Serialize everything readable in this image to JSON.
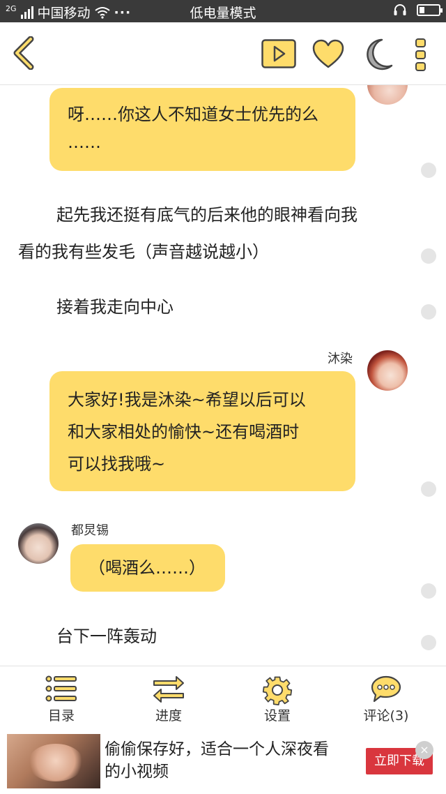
{
  "status_bar": {
    "network": "2G",
    "carrier": "中国移动",
    "dots": "···",
    "mode": "低电量模式",
    "battery_level": 0.25
  },
  "toolbar": {
    "icons": [
      "back-icon",
      "play-icon",
      "heart-icon",
      "moon-icon",
      "more-icon"
    ],
    "accent": "#fedc6b"
  },
  "chat": {
    "msg1": {
      "line1": "呀……你这人不知道女士优先的么",
      "line2": "……"
    },
    "narr1": {
      "line1": "起先我还挺有底气的后来他的眼神看向我",
      "line2": "看的我有些发毛（声音越说越小）"
    },
    "narr2": "接着我走向中心",
    "msg2": {
      "name": "沐染",
      "line1": "大家好!我是沐染~希望以后可以",
      "line2": "和大家相处的愉快~还有喝酒时",
      "line3": "可以找我哦~"
    },
    "msg3": {
      "name": "都炅锡",
      "text": "（喝酒么……）"
    },
    "narr3": "台下一阵轰动"
  },
  "bottom_nav": {
    "catalog": "目录",
    "progress": "进度",
    "settings": "设置",
    "comments": "评论(3)"
  },
  "ad": {
    "text_line1": "偷偷保存好，适合一个人深夜看",
    "text_line2": "的小视频",
    "cta": "立即下载",
    "close": "×"
  }
}
